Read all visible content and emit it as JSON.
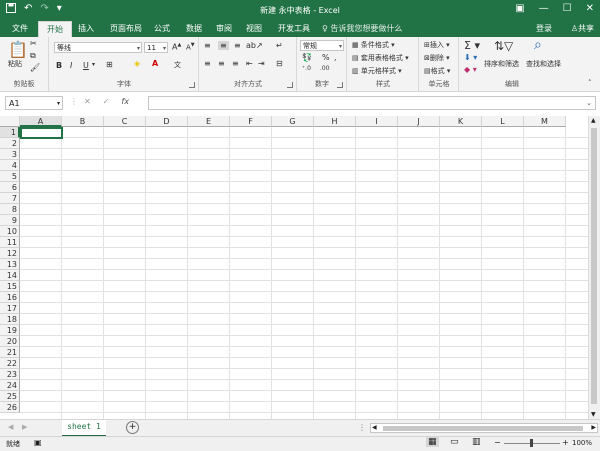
{
  "window": {
    "title": "新建 永中表格 - Excel"
  },
  "tabs": [
    {
      "label": "文件"
    },
    {
      "label": "开始"
    },
    {
      "label": "插入"
    },
    {
      "label": "页面布局"
    },
    {
      "label": "公式"
    },
    {
      "label": "数据"
    },
    {
      "label": "审阅"
    },
    {
      "label": "视图"
    },
    {
      "label": "开发工具"
    }
  ],
  "tell_me": "告诉我您想要做什么",
  "account": {
    "signin": "登录",
    "share": "共享"
  },
  "ribbon": {
    "clipboard": {
      "label": "剪贴板",
      "paste": "粘贴"
    },
    "font": {
      "label": "字体",
      "name": "等线",
      "size": "11",
      "bold": "B",
      "italic": "I",
      "underline": "U"
    },
    "alignment": {
      "label": "对齐方式"
    },
    "number": {
      "label": "数字",
      "format": "常规",
      "percent": "%"
    },
    "styles": {
      "label": "样式",
      "conditional": "条件格式",
      "table": "套用表格格式",
      "cell": "单元格样式"
    },
    "cells": {
      "label": "单元格",
      "insert": "插入",
      "delete": "删除",
      "format": "格式"
    },
    "editing": {
      "label": "编辑",
      "sort": "排序和筛选",
      "find": "查找和选择"
    }
  },
  "formula_bar": {
    "name_box": "A1",
    "fx": "fx",
    "value": ""
  },
  "columns": [
    "A",
    "B",
    "C",
    "D",
    "E",
    "F",
    "G",
    "H",
    "I",
    "J",
    "K",
    "L",
    "M"
  ],
  "rows": [
    "1",
    "2",
    "3",
    "4",
    "5",
    "6",
    "7",
    "8",
    "9",
    "10",
    "11",
    "12",
    "13",
    "14",
    "15",
    "16",
    "17",
    "18",
    "19",
    "20",
    "21",
    "22",
    "23",
    "24",
    "25",
    "26"
  ],
  "sheets": [
    {
      "name": "sheet 1",
      "active": true
    }
  ],
  "status": {
    "ready": "就绪",
    "zoom": "100%"
  },
  "colors": {
    "accent": "#217346"
  }
}
